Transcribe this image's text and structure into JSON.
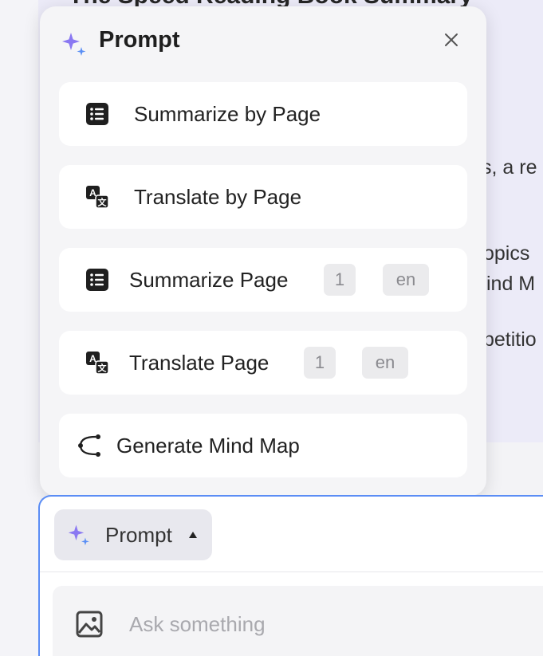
{
  "background": {
    "doc_title": "The Speed Reading Book Summary",
    "lines": [
      "s, a re",
      "opics",
      "ind M",
      "petitio"
    ]
  },
  "popup": {
    "title": "Prompt",
    "close_icon": "close-icon",
    "items": [
      {
        "icon": "list-icon",
        "label": "Summarize by Page"
      },
      {
        "icon": "translate-icon",
        "label": "Translate by Page"
      },
      {
        "icon": "list-icon",
        "label": "Summarize Page",
        "page": "1",
        "lang": "en"
      },
      {
        "icon": "translate-icon",
        "label": "Translate Page",
        "page": "1",
        "lang": "en"
      },
      {
        "icon": "mind-map-icon",
        "label": "Generate Mind Map"
      }
    ]
  },
  "composer": {
    "prompt_button_label": "Prompt",
    "ask_placeholder": "Ask something"
  },
  "colors": {
    "accent_border": "#5b8df5",
    "sparkle": "#7b6cf0",
    "chip_bg": "#ebebed"
  }
}
